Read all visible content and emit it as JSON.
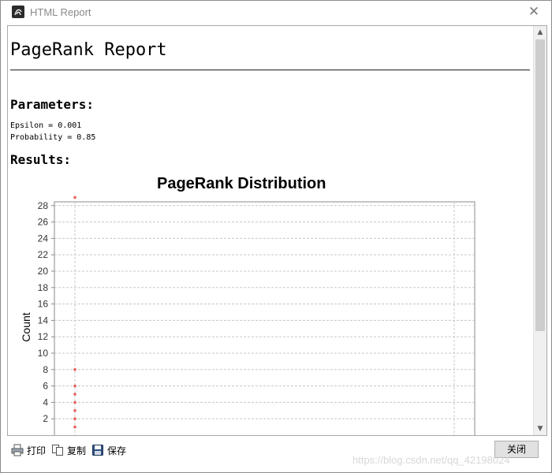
{
  "window": {
    "title": "HTML Report",
    "close_glyph": "✕"
  },
  "report": {
    "title": "PageRank Report",
    "parameters_heading": "Parameters:",
    "epsilon_line": "Epsilon = 0.001",
    "probability_line": "Probability = 0.85",
    "results_heading": "Results:"
  },
  "chart_data": {
    "type": "scatter",
    "title": "PageRank Distribution",
    "xlabel": "",
    "ylabel": "Count",
    "ylim": [
      0,
      29
    ],
    "y_ticks": [
      "2",
      "4",
      "6",
      "8",
      "10",
      "12",
      "14",
      "16",
      "18",
      "20",
      "22",
      "24",
      "26",
      "28"
    ],
    "grid": true,
    "point_color": "#e8625a",
    "points": [
      {
        "y": 29
      },
      {
        "y": 8
      },
      {
        "y": 6
      },
      {
        "y": 5
      },
      {
        "y": 4
      },
      {
        "y": 3
      },
      {
        "y": 2
      },
      {
        "y": 1
      }
    ]
  },
  "scrollbar": {
    "up_glyph": "▲",
    "down_glyph": "▼"
  },
  "toolbar": {
    "print_label": "打印",
    "copy_label": "复制",
    "save_label": "保存",
    "close_label": "关闭",
    "print_icon": "printer-icon",
    "copy_icon": "copy-icon",
    "save_icon": "floppy-disk-icon"
  },
  "watermark": "https://blog.csdn.net/qq_42198024"
}
